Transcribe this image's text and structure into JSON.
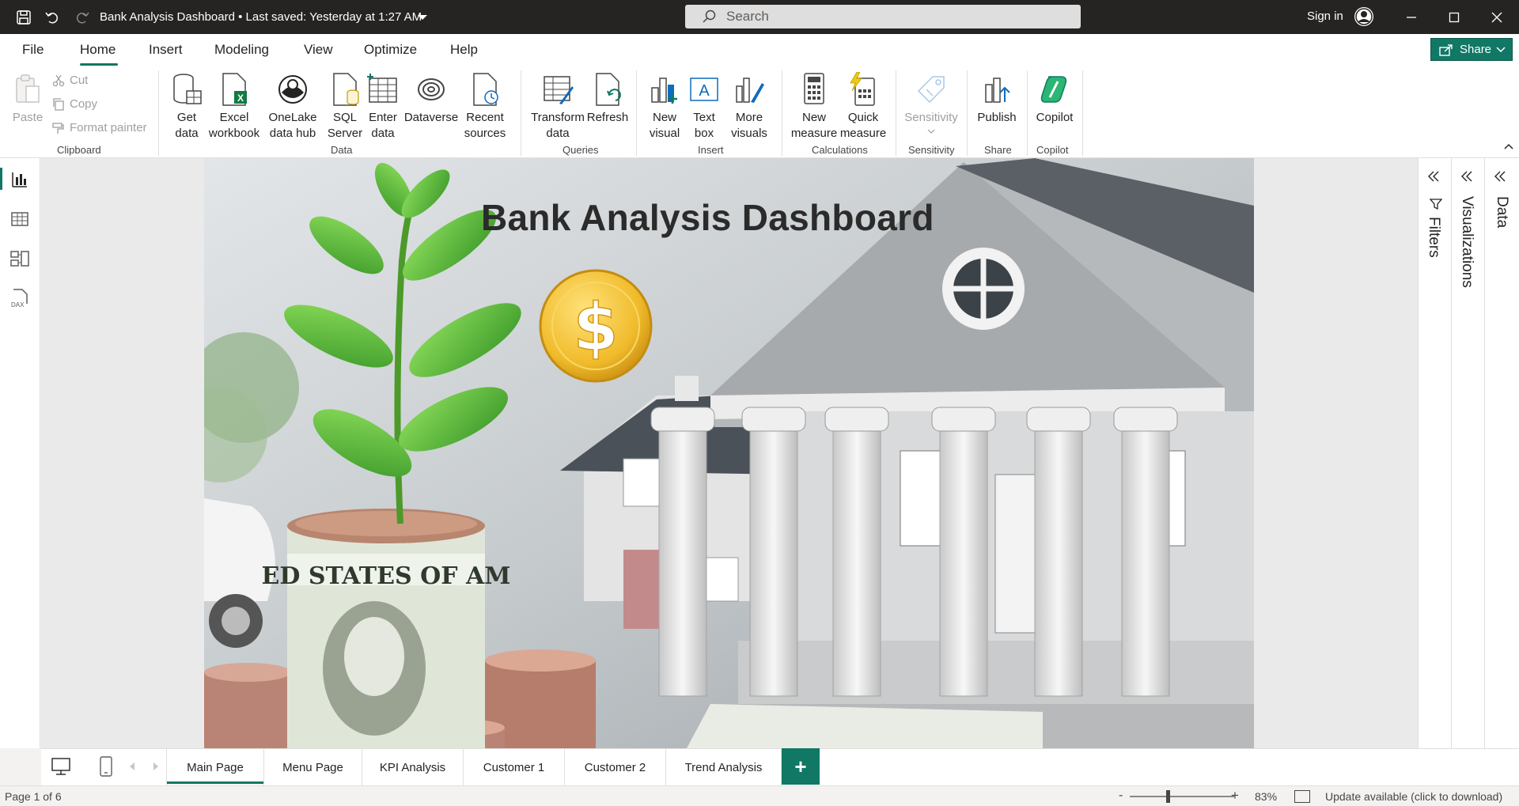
{
  "titlebar": {
    "document_title": "Bank Analysis Dashboard • Last saved: Yesterday at 1:27 AM",
    "search_placeholder": "Search",
    "sign_in": "Sign in"
  },
  "menu": {
    "tabs": [
      "File",
      "Home",
      "Insert",
      "Modeling",
      "View",
      "Optimize",
      "Help"
    ],
    "active_tab": "Home",
    "share_label": "Share"
  },
  "ribbon": {
    "clipboard": {
      "paste": "Paste",
      "cut": "Cut",
      "copy": "Copy",
      "format_painter": "Format painter",
      "group": "Clipboard"
    },
    "data": {
      "get_data": [
        "Get",
        "data"
      ],
      "excel": [
        "Excel",
        "workbook"
      ],
      "onelake": [
        "OneLake",
        "data hub"
      ],
      "sql": [
        "SQL",
        "Server"
      ],
      "enter": [
        "Enter",
        "data"
      ],
      "dataverse": "Dataverse",
      "recent": [
        "Recent",
        "sources"
      ],
      "group": "Data"
    },
    "queries": {
      "transform": [
        "Transform",
        "data"
      ],
      "refresh": "Refresh",
      "group": "Queries"
    },
    "insert": {
      "new_visual": [
        "New",
        "visual"
      ],
      "text_box": [
        "Text",
        "box"
      ],
      "more_visuals": [
        "More",
        "visuals"
      ],
      "group": "Insert"
    },
    "calculations": {
      "new_measure": [
        "New",
        "measure"
      ],
      "quick_measure": [
        "Quick",
        "measure"
      ],
      "group": "Calculations"
    },
    "sensitivity": {
      "label": "Sensitivity",
      "group": "Sensitivity"
    },
    "share": {
      "publish": "Publish",
      "group": "Share"
    },
    "copilot": {
      "label": "Copilot",
      "group": "Copilot"
    }
  },
  "report": {
    "title": "Bank Analysis Dashboard",
    "banknote_text": "ED STATES OF AM"
  },
  "panes": {
    "filters": "Filters",
    "visualizations": "Visualizations",
    "data": "Data"
  },
  "pages": {
    "tabs": [
      "Main Page",
      "Menu Page",
      "KPI Analysis",
      "Customer 1",
      "Customer 2",
      "Trend Analysis"
    ],
    "active": "Main Page",
    "add": "+"
  },
  "status": {
    "page_info": "Page 1 of 6",
    "zoom_minus": "-",
    "zoom_plus": "+",
    "zoom": "83%",
    "update": "Update available (click to download)"
  },
  "colors": {
    "accent": "#117865",
    "titlebar": "#252423",
    "ribbon": "#ffffff"
  }
}
